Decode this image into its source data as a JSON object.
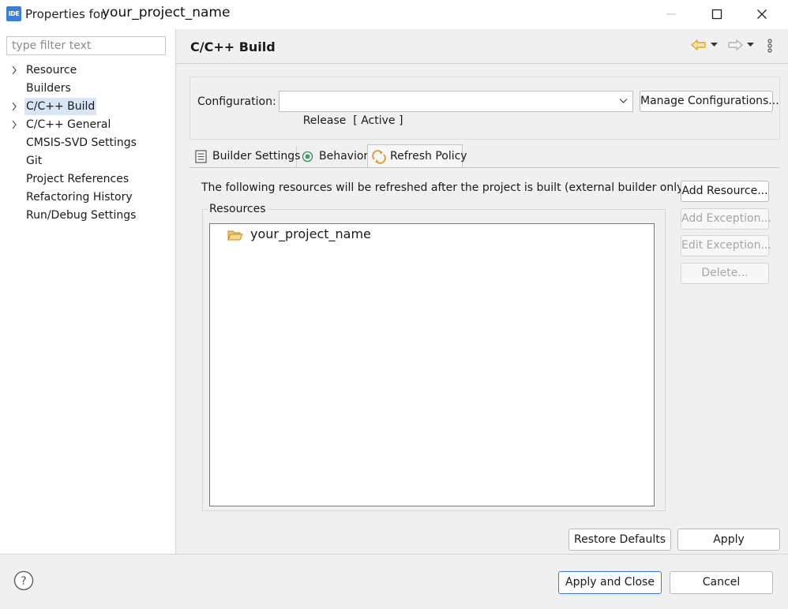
{
  "window": {
    "app_icon_text": "IDE",
    "title_prefix": "Properties for",
    "title_project": "your_project_name"
  },
  "sidebar": {
    "filter_placeholder": "type filter text",
    "items": [
      {
        "label": "Resource",
        "expandable": true,
        "selected": false
      },
      {
        "label": "Builders",
        "expandable": false,
        "selected": false
      },
      {
        "label": "C/C++ Build",
        "expandable": true,
        "selected": true
      },
      {
        "label": "C/C++ General",
        "expandable": true,
        "selected": false
      },
      {
        "label": "CMSIS-SVD Settings",
        "expandable": false,
        "selected": false
      },
      {
        "label": "Git",
        "expandable": false,
        "selected": false
      },
      {
        "label": "Project References",
        "expandable": false,
        "selected": false
      },
      {
        "label": "Refactoring History",
        "expandable": false,
        "selected": false
      },
      {
        "label": "Run/Debug Settings",
        "expandable": false,
        "selected": false
      }
    ]
  },
  "main": {
    "page_title": "C/C++ Build",
    "config": {
      "label": "Configuration:",
      "value": "Release  [ Active ]",
      "manage_label": "Manage Configurations..."
    },
    "tabs": [
      {
        "label": "Builder Settings",
        "icon": "list-icon",
        "active": false
      },
      {
        "label": "Behavior",
        "icon": "radio-target-icon",
        "active": false
      },
      {
        "label": "Refresh Policy",
        "icon": "refresh-arrows-icon",
        "active": true
      }
    ],
    "refresh_description": "The following resources will be refreshed after the project is built (external builder only):",
    "resources": {
      "legend": "Resources",
      "items": [
        "your_project_name"
      ]
    },
    "side_buttons": [
      {
        "label": "Add Resource...",
        "enabled": true
      },
      {
        "label": "Add Exception...",
        "enabled": false
      },
      {
        "label": "Edit Exception...",
        "enabled": false
      },
      {
        "label": "Delete...",
        "enabled": false
      }
    ],
    "restore_defaults_label": "Restore Defaults",
    "apply_label": "Apply"
  },
  "footer": {
    "help_glyph": "?",
    "apply_close_label": "Apply and Close",
    "cancel_label": "Cancel"
  },
  "colors": {
    "accent": "#3b7dd8",
    "selection": "#d7e6f7",
    "folder": "#e8a93b",
    "nav_arrow": "#e0a72a"
  }
}
